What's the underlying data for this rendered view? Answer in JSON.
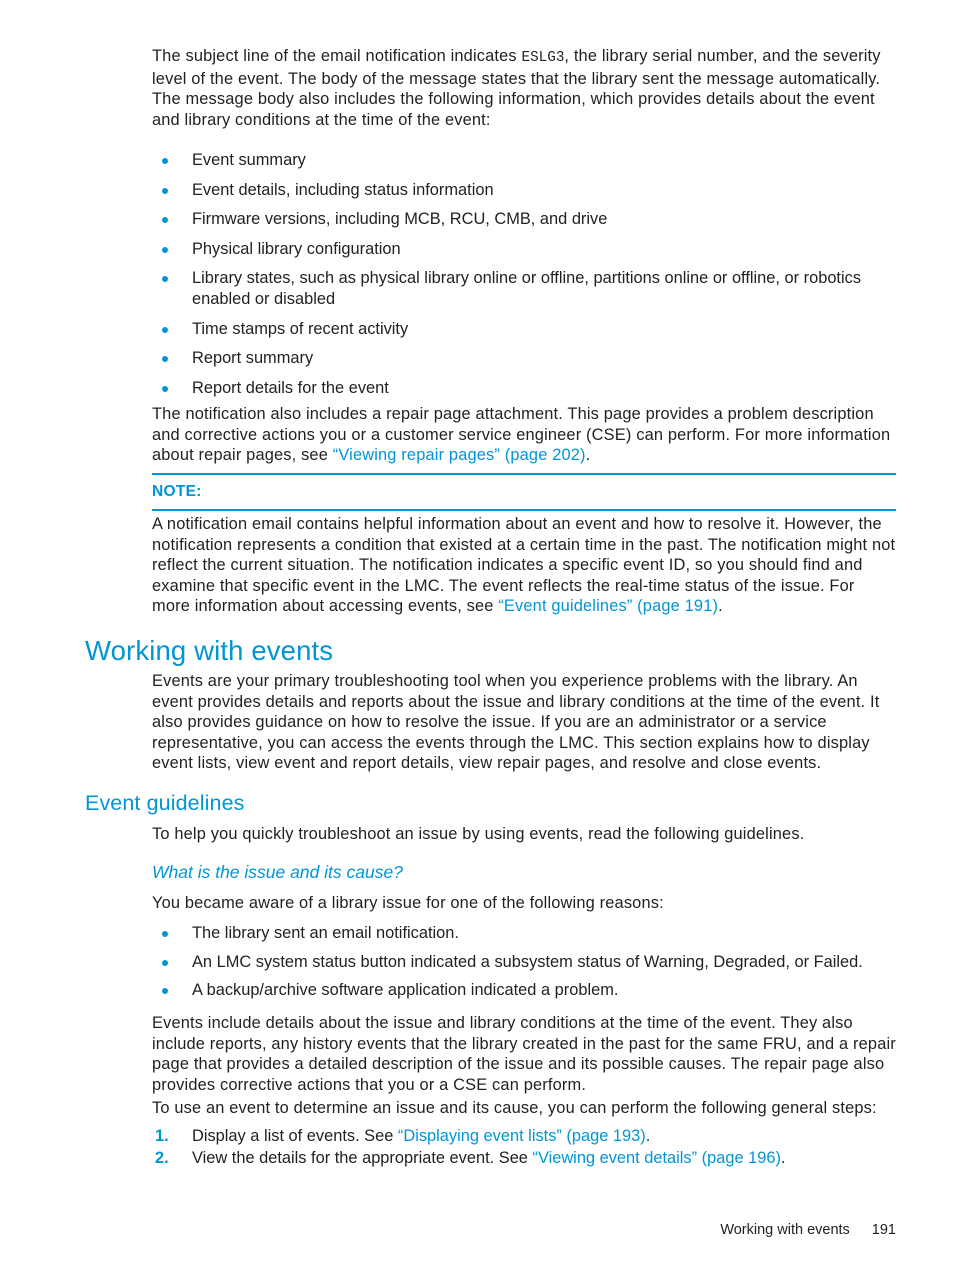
{
  "document": {
    "intro_paragraph": {
      "before_code": "The subject line of the email notification indicates ",
      "code": "ESLG3",
      "after_code": ", the library serial number, and the severity level of the event. The body of the message states that the library sent the message automatically. The message body also includes the following information, which provides details about the event and library conditions at the time of the event:"
    },
    "intro_bullets": [
      "Event summary",
      "Event details, including status information",
      "Firmware versions, including MCB, RCU, CMB, and drive",
      "Physical library configuration",
      "Library states, such as physical library online or offline, partitions online or offline, or robotics enabled or disabled",
      "Time stamps of recent activity",
      "Report summary",
      "Report details for the event"
    ],
    "repair_paragraph": {
      "text_before_link": "The notification also includes a repair page attachment. This page provides a problem description and corrective actions you or a customer service engineer (CSE) can perform. For more information about repair pages, see ",
      "link": "“Viewing repair pages” (page 202)",
      "text_after_link": "."
    },
    "note": {
      "label": "NOTE:",
      "text_before_link": "A notification email contains helpful information about an event and how to resolve it. However, the notification represents a condition that existed at a certain time in the past. The notification might not reflect the current situation. The notification indicates a specific event ID, so you should find and examine that specific event in the LMC. The event reflects the real-time status of the issue. For more information about accessing events, see ",
      "link": "“Event guidelines” (page 191)",
      "text_after_link": "."
    },
    "heading_working_with_events": "Working with events",
    "working_with_events_paragraph": "Events are your primary troubleshooting tool when you experience problems with the library. An event provides details and reports about the issue and library conditions at the time of the event. It also provides guidance on how to resolve the issue. If you are an administrator or a service representative, you can access the events through the LMC. This section explains how to display event lists, view event and report details, view repair pages, and resolve and close events.",
    "heading_event_guidelines": "Event guidelines",
    "event_guidelines_paragraph": "To help you quickly troubleshoot an issue by using events, read the following guidelines.",
    "heading_what_is_the_issue": "What is the issue and its cause?",
    "aware_paragraph": "You became aware of a library issue for one of the following reasons:",
    "aware_bullets": [
      "The library sent an email notification.",
      "An LMC system status button indicated a subsystem status of Warning, Degraded, or Failed.",
      "A backup/archive software application indicated a problem."
    ],
    "events_include_paragraph": "Events include details about the issue and library conditions at the time of the event. They also include reports, any history events that the library created in the past for the same FRU, and a repair page that provides a detailed description of the issue and its possible causes. The repair page also provides corrective actions that you or a CSE can perform.",
    "to_use_paragraph": "To use an event to determine an issue and its cause, you can perform the following general steps:",
    "steps": [
      {
        "number": "1.",
        "text_before_link": "Display a list of events. See ",
        "link": "“Displaying event lists” (page 193)",
        "text_after_link": "."
      },
      {
        "number": "2.",
        "text_before_link": "View the details for the appropriate event. See ",
        "link": "“Viewing event details” (page 196)",
        "text_after_link": "."
      }
    ],
    "footer": {
      "chapter": "Working with events",
      "page_number": "191"
    },
    "colors": {
      "accent": "#0096d6",
      "text": "#231f20",
      "background": "#ffffff"
    }
  }
}
